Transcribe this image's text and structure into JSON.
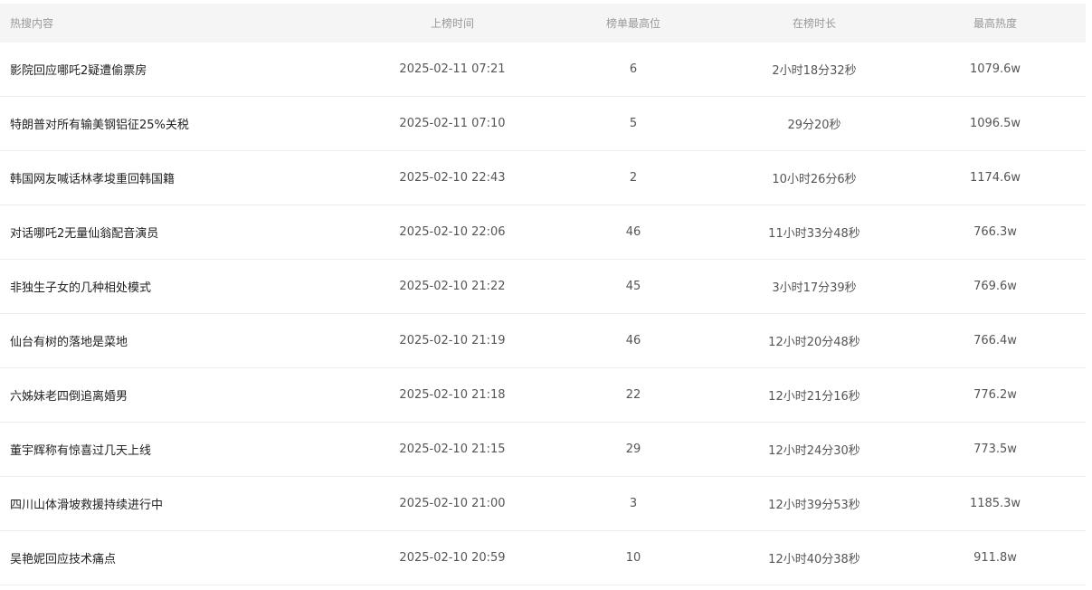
{
  "table": {
    "headers": [
      "热搜内容",
      "上榜时间",
      "榜单最高位",
      "在榜时长",
      "最高热度"
    ],
    "rows": [
      [
        "影院回应哪吒2疑遭偷票房",
        "2025-02-11 07:21",
        "6",
        "2小时18分32秒",
        "1079.6w"
      ],
      [
        "特朗普对所有输美钢铝征25%关税",
        "2025-02-11 07:10",
        "5",
        "29分20秒",
        "1096.5w"
      ],
      [
        "韩国网友喊话林孝埈重回韩国籍",
        "2025-02-10 22:43",
        "2",
        "10小时26分6秒",
        "1174.6w"
      ],
      [
        "对话哪吒2无量仙翁配音演员",
        "2025-02-10 22:06",
        "46",
        "11小时33分48秒",
        "766.3w"
      ],
      [
        "非独生子女的几种相处模式",
        "2025-02-10 21:22",
        "45",
        "3小时17分39秒",
        "769.6w"
      ],
      [
        "仙台有树的落地是菜地",
        "2025-02-10 21:19",
        "46",
        "12小时20分48秒",
        "766.4w"
      ],
      [
        "六姊妹老四倒追离婚男",
        "2025-02-10 21:18",
        "22",
        "12小时21分16秒",
        "776.2w"
      ],
      [
        "董宇辉称有惊喜过几天上线",
        "2025-02-10 21:15",
        "29",
        "12小时24分30秒",
        "773.5w"
      ],
      [
        "四川山体滑坡救援持续进行中",
        "2025-02-10 21:00",
        "3",
        "12小时39分53秒",
        "1185.3w"
      ],
      [
        "吴艳妮回应技术痛点",
        "2025-02-10 20:59",
        "10",
        "12小时40分38秒",
        "911.8w"
      ]
    ]
  }
}
